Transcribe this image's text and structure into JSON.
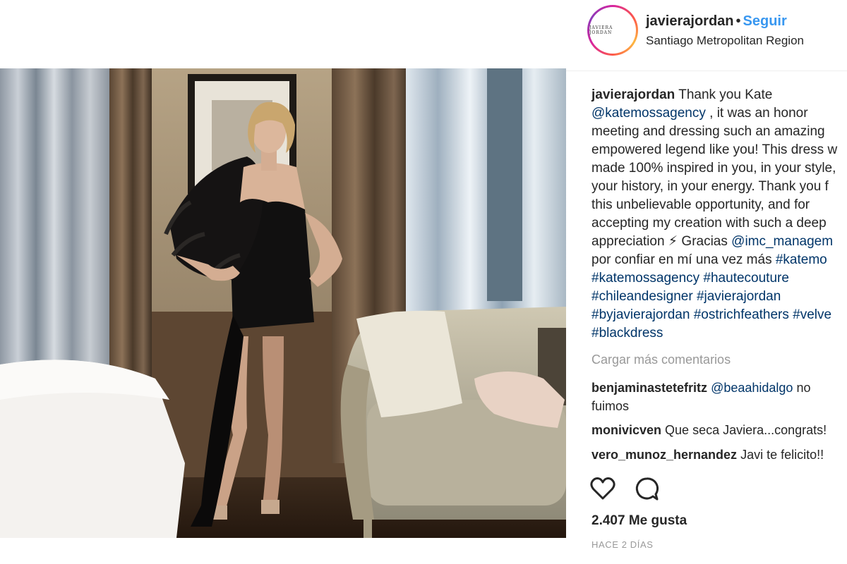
{
  "header": {
    "avatar_text": "JAVIERA JORDAN",
    "username": "javierajordan",
    "separator": "•",
    "follow_label": "Seguir",
    "location": "Santiago Metropolitan Region"
  },
  "photo": {
    "icon": "photo-image"
  },
  "caption": {
    "username": "javierajordan",
    "line1_text": " Thank you Kate",
    "line2_mention": "@katemossagency",
    "line2_text": " , it was an honor",
    "line3": "meeting and dressing such an amazing",
    "line4": "empowered legend like you! This dress w",
    "line5": "made 100% inspired in you, in your style,",
    "line6": "your history, in your energy. Thank you f",
    "line7": "this unbelievable opportunity, and for",
    "line8": "accepting my creation with such a deep",
    "line9_text": "appreciation ⚡ Gracias ",
    "line9_mention": "@imc_managem",
    "line10_text": "por confiar en mí una vez más ",
    "line10_tag": "#katemo",
    "line11": "#katemossagency #hautecouture",
    "line12": "#chileandesigner #javierajordan",
    "line13": "#byjavierajordan #ostrichfeathers #velve",
    "line14": "#blackdress"
  },
  "load_more_label": "Cargar más comentarios",
  "comments": [
    {
      "username": "benjaminastetefritz",
      "mention": "@beaahidalgo",
      "text_after": " no",
      "line2": "fuimos"
    },
    {
      "username": "monivicven",
      "text": " Que seca Javiera...congrats!"
    },
    {
      "username": "vero_munoz_hernandez",
      "text": " Javi te felicito!!"
    }
  ],
  "actions": {
    "like_icon": "heart-icon",
    "comment_icon": "comment-icon"
  },
  "likes_text": "2.407 Me gusta",
  "timestamp": "HACE 2 DÍAS",
  "colors": {
    "link_blue": "#3897f0",
    "mention_dark_blue": "#003569",
    "muted_gray": "#999999",
    "text": "#262626"
  }
}
